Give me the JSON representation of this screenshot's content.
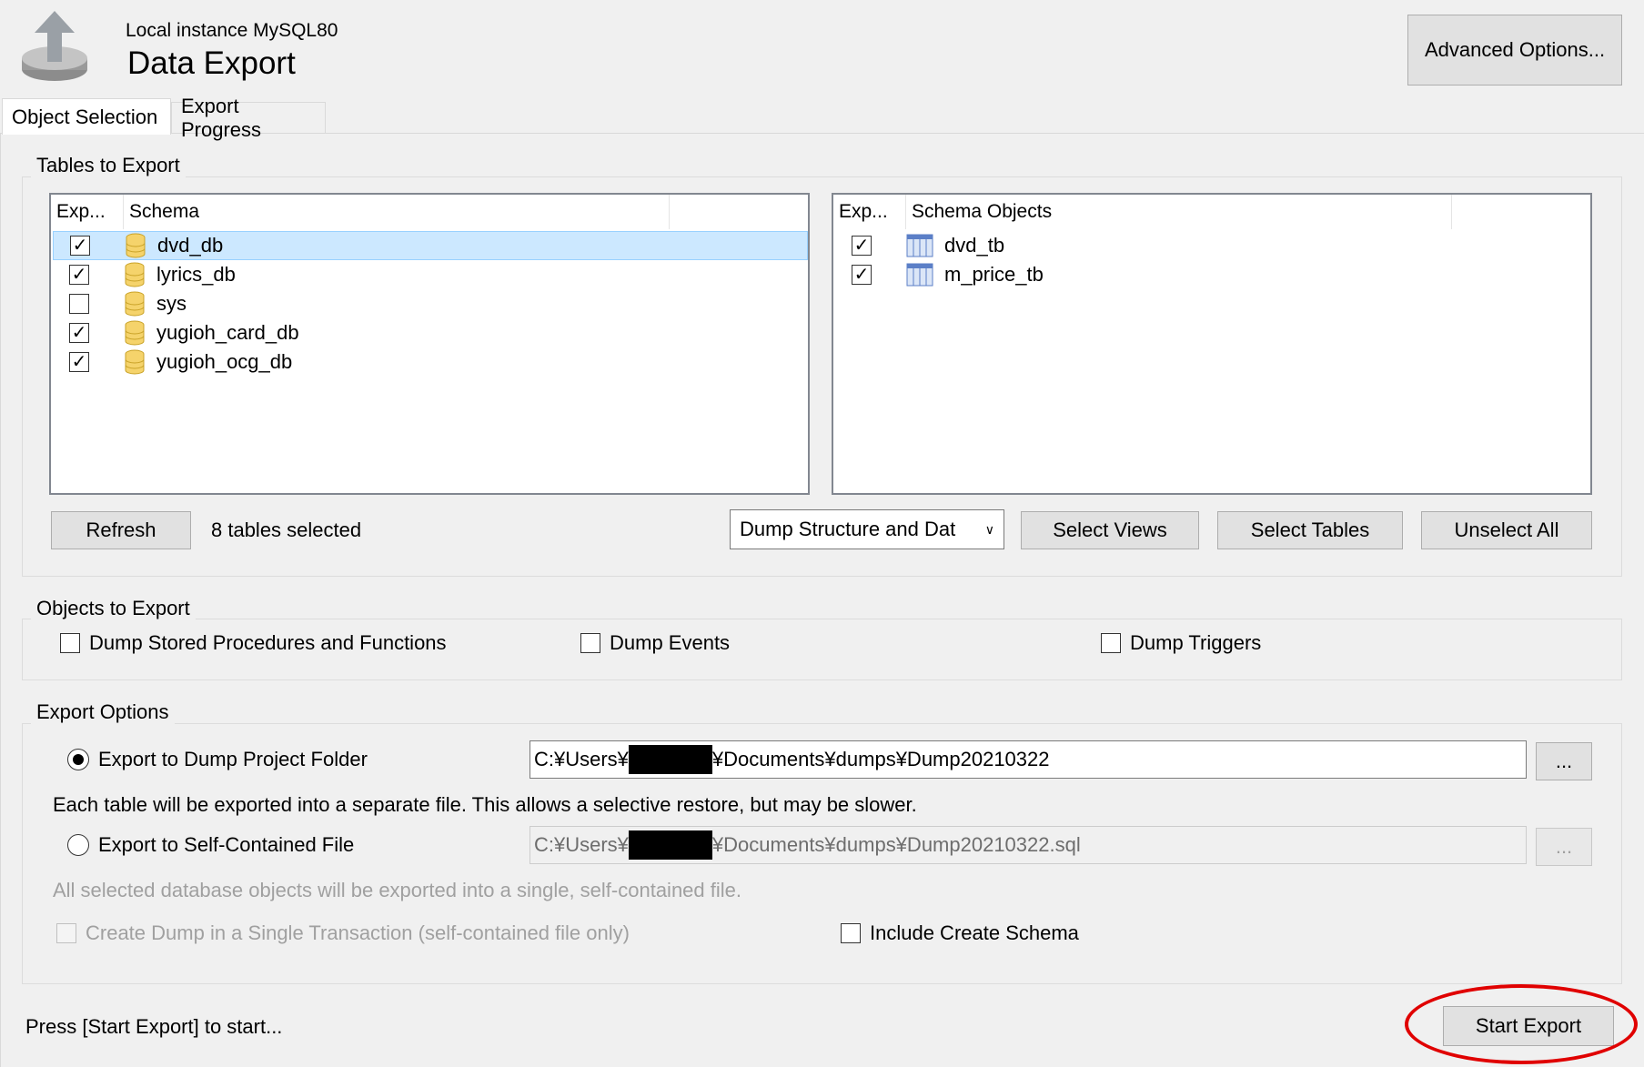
{
  "header": {
    "instance": "Local instance MySQL80",
    "title": "Data Export",
    "advanced_options": "Advanced Options..."
  },
  "tabs": [
    {
      "label": "Object Selection",
      "active": true
    },
    {
      "label": "Export Progress",
      "active": false
    }
  ],
  "tables_to_export": {
    "group_label": "Tables to Export",
    "left_columns": [
      "Exp...",
      "Schema"
    ],
    "schemas": [
      {
        "name": "dvd_db",
        "checked": true,
        "selected": true
      },
      {
        "name": "lyrics_db",
        "checked": true,
        "selected": false
      },
      {
        "name": "sys",
        "checked": false,
        "selected": false
      },
      {
        "name": "yugioh_card_db",
        "checked": true,
        "selected": false
      },
      {
        "name": "yugioh_ocg_db",
        "checked": true,
        "selected": false
      }
    ],
    "right_columns": [
      "Exp...",
      "Schema Objects"
    ],
    "objects": [
      {
        "name": "dvd_tb",
        "checked": true
      },
      {
        "name": "m_price_tb",
        "checked": true
      }
    ],
    "refresh": "Refresh",
    "selected_count": "8 tables selected",
    "dump_mode": "Dump Structure and Dat",
    "select_views": "Select Views",
    "select_tables": "Select Tables",
    "unselect_all": "Unselect All"
  },
  "objects_to_export": {
    "group_label": "Objects to Export",
    "stored_procedures": "Dump Stored Procedures and Functions",
    "events": "Dump Events",
    "triggers": "Dump Triggers"
  },
  "export_options": {
    "group_label": "Export Options",
    "project_folder_label": "Export to Dump Project Folder",
    "project_folder_path_prefix": "C:¥Users¥",
    "project_folder_path_suffix": "¥Documents¥dumps¥Dump20210322",
    "project_folder_note": "Each table will be exported into a separate file. This allows a selective restore, but may be slower.",
    "self_contained_label": "Export to Self-Contained File",
    "self_contained_path_prefix": "C:¥Users¥",
    "self_contained_path_suffix": "¥Documents¥dumps¥Dump20210322.sql",
    "self_contained_note": "All selected database objects will be exported into a single, self-contained file.",
    "single_transaction": "Create Dump in a Single Transaction (self-contained file only)",
    "include_create_schema": "Include Create Schema",
    "browse": "..."
  },
  "footer": {
    "status": "Press [Start Export] to start...",
    "start_export": "Start Export"
  },
  "colors": {
    "highlight_row": "#cce8ff",
    "annotation_red": "#e00000"
  }
}
